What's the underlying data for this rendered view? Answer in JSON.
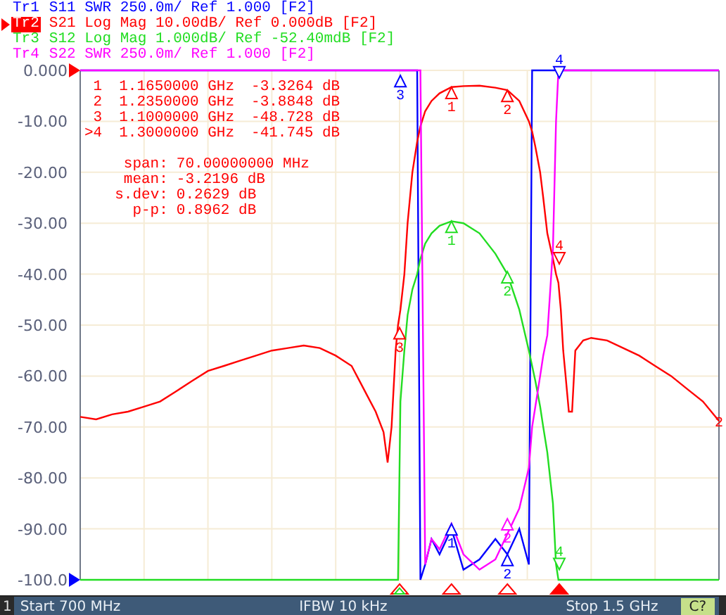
{
  "traces": [
    {
      "name": "Tr1",
      "description": "S11 SWR 250.0m/ Ref 1.000 [F2]",
      "color": "#0000ff",
      "selected": false
    },
    {
      "name": "Tr2",
      "description": "S21 Log Mag 10.00dB/ Ref 0.000dB [F2]",
      "color": "#ff0000",
      "selected": true
    },
    {
      "name": "Tr3",
      "description": "S12 Log Mag 1.000dB/ Ref -52.40mdB [F2]",
      "color": "#22dd22",
      "selected": false
    },
    {
      "name": "Tr4",
      "description": "S22 SWR 250.0m/ Ref 1.000 [F2]",
      "color": "#ff00ff",
      "selected": false
    }
  ],
  "chart": {
    "y_axis_labels": [
      "0.000",
      "-10.00",
      "-20.00",
      "-30.00",
      "-40.00",
      "-50.00",
      "-60.00",
      "-70.00",
      "-80.00",
      "-90.00",
      "-100.0"
    ],
    "trace_end_label": "2",
    "trace_markers": [
      {
        "label": "1",
        "color": "#ff0000"
      },
      {
        "label": "2",
        "color": "#ff0000"
      },
      {
        "label": "3",
        "color": "#ff0000"
      },
      {
        "label": "4",
        "color": "#ff0000"
      },
      {
        "label": "1",
        "color": "#22dd22"
      },
      {
        "label": "2",
        "color": "#22dd22"
      },
      {
        "label": "4",
        "color": "#22dd22"
      },
      {
        "label": "3",
        "color": "#0000ff"
      },
      {
        "label": "4",
        "color": "#0000ff"
      },
      {
        "label": "2",
        "color": "#ff00ff"
      },
      {
        "label": "1",
        "color": "#0000ff"
      },
      {
        "label": "2",
        "color": "#0000ff"
      }
    ],
    "stimulus_markers": [
      {
        "color": "#ff0000",
        "active": false
      },
      {
        "color": "#22dd22",
        "active": false
      },
      {
        "color": "#ff0000",
        "active": false
      },
      {
        "color": "#ff0000",
        "active": false
      },
      {
        "color": "#ff0000",
        "active": true
      }
    ]
  },
  "markers": [
    {
      "label": "1",
      "frequency": "1.1650000 GHz",
      "value": "-3.3264 dB"
    },
    {
      "label": "2",
      "frequency": "1.2350000 GHz",
      "value": "-3.8848 dB"
    },
    {
      "label": "3",
      "frequency": "1.1000000 GHz",
      "value": "-48.728 dB"
    },
    {
      "label": ">4",
      "frequency": "1.3000000 GHz",
      "value": "-41.745 dB"
    }
  ],
  "statistics": [
    {
      "label": "span:",
      "value": "70.00000000 MHz"
    },
    {
      "label": "mean:",
      "value": "-3.2196 dB"
    },
    {
      "label": "s.dev:",
      "value": "0.2629 dB"
    },
    {
      "label": "p-p:",
      "value": "0.8962 dB"
    }
  ],
  "status_bar": {
    "channel": "1",
    "start": "Start 700 MHz",
    "ifbw": "IFBW 10 kHz",
    "stop": "Stop 1.5 GHz",
    "calibration": "C?"
  }
}
